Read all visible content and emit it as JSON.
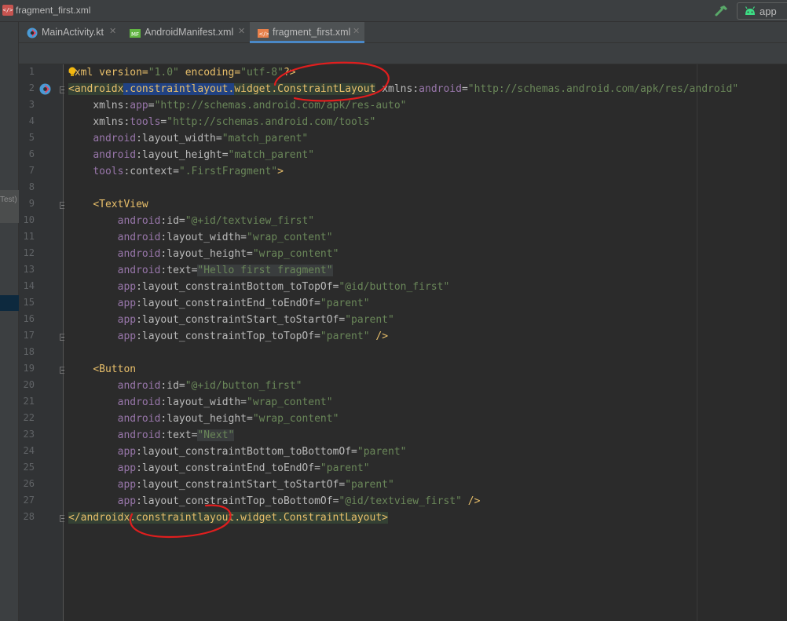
{
  "window": {
    "title": "fragment_first.xml"
  },
  "toolbar": {
    "run_config_label": "app",
    "build_icon": "hammer-icon",
    "android_icon": "android-icon"
  },
  "left_strip": {
    "partial_label": "Test)"
  },
  "tabs": [
    {
      "label": "MainActivity.kt",
      "icon": "kotlin-file-icon",
      "active": false,
      "close": "✕"
    },
    {
      "label": "AndroidManifest.xml",
      "icon": "manifest-file-icon",
      "active": false,
      "close": "✕"
    },
    {
      "label": "fragment_first.xml",
      "icon": "xml-file-icon",
      "active": true,
      "close": "✕"
    }
  ],
  "gutter": {
    "line_numbers": [
      "1",
      "2",
      "3",
      "4",
      "5",
      "6",
      "7",
      "8",
      "9",
      "10",
      "11",
      "12",
      "13",
      "14",
      "15",
      "16",
      "17",
      "18",
      "19",
      "20",
      "21",
      "22",
      "23",
      "24",
      "25",
      "26",
      "27",
      "28"
    ]
  },
  "code": {
    "l1": {
      "lt": "<",
      "pi": "xml version=",
      "v1": "\"1.0\"",
      "sp": " encoding=",
      "v2": "\"utf-8\"",
      "end": "?>"
    },
    "l2": {
      "open": "<",
      "seg1": "androidx",
      "dot1": ".",
      "seg2": "constraintlayout",
      "dot2": ".",
      "seg3": "widget",
      "dot3": ".",
      "seg4": "ConstraintLayout",
      "sp": " ",
      "attr": "xmlns:",
      "ns": "android",
      "eq": "=",
      "val": "\"http://schemas.android.com/apk/res/android\""
    },
    "l3": {
      "attr": "xmlns:",
      "ns": "app",
      "eq": "=",
      "val": "\"http://schemas.android.com/apk/res-auto\""
    },
    "l4": {
      "attr": "xmlns:",
      "ns": "tools",
      "eq": "=",
      "val": "\"http://schemas.android.com/tools\""
    },
    "l5": {
      "ns": "android",
      "attr": ":layout_width",
      "eq": "=",
      "val": "\"match_parent\""
    },
    "l6": {
      "ns": "android",
      "attr": ":layout_height",
      "eq": "=",
      "val": "\"match_parent\""
    },
    "l7": {
      "ns": "tools",
      "attr": ":context",
      "eq": "=",
      "val": "\".FirstFragment\"",
      "end": ">"
    },
    "l9": {
      "tag": "<TextView"
    },
    "l10": {
      "ns": "android",
      "attr": ":id",
      "eq": "=",
      "val": "\"@+id/textview_first\""
    },
    "l11": {
      "ns": "android",
      "attr": ":layout_width",
      "eq": "=",
      "val": "\"wrap_content\""
    },
    "l12": {
      "ns": "android",
      "attr": ":layout_height",
      "eq": "=",
      "val": "\"wrap_content\""
    },
    "l13": {
      "ns": "android",
      "attr": ":text",
      "eq": "=",
      "val": "\"Hello first fragment\""
    },
    "l14": {
      "ns": "app",
      "attr": ":layout_constraintBottom_toTopOf",
      "eq": "=",
      "val": "\"@id/button_first\""
    },
    "l15": {
      "ns": "app",
      "attr": ":layout_constraintEnd_toEndOf",
      "eq": "=",
      "val": "\"parent\""
    },
    "l16": {
      "ns": "app",
      "attr": ":layout_constraintStart_toStartOf",
      "eq": "=",
      "val": "\"parent\""
    },
    "l17": {
      "ns": "app",
      "attr": ":layout_constraintTop_toTopOf",
      "eq": "=",
      "val": "\"parent\"",
      "end": " />"
    },
    "l19": {
      "tag": "<Button"
    },
    "l20": {
      "ns": "android",
      "attr": ":id",
      "eq": "=",
      "val": "\"@+id/button_first\""
    },
    "l21": {
      "ns": "android",
      "attr": ":layout_width",
      "eq": "=",
      "val": "\"wrap_content\""
    },
    "l22": {
      "ns": "android",
      "attr": ":layout_height",
      "eq": "=",
      "val": "\"wrap_content\""
    },
    "l23": {
      "ns": "android",
      "attr": ":text",
      "eq": "=",
      "val": "\"Next\""
    },
    "l24": {
      "ns": "app",
      "attr": ":layout_constraintBottom_toBottomOf",
      "eq": "=",
      "val": "\"parent\""
    },
    "l25": {
      "ns": "app",
      "attr": ":layout_constraintEnd_toEndOf",
      "eq": "=",
      "val": "\"parent\""
    },
    "l26": {
      "ns": "app",
      "attr": ":layout_constraintStart_toStartOf",
      "eq": "=",
      "val": "\"parent\""
    },
    "l27": {
      "ns": "app",
      "attr": ":layout_constraintTop_toBottomOf",
      "eq": "=",
      "val": "\"@id/textview_first\"",
      "end": " />"
    },
    "l28": {
      "tag": "</androidx.constraintlayout.widget.ConstraintLayout>"
    }
  },
  "colors": {
    "tag": "#e8bf6a",
    "namespace": "#9876aa",
    "string": "#6a8759",
    "text": "#a9b7c6",
    "selection": "#214283",
    "annotation": "#e01e1e"
  }
}
